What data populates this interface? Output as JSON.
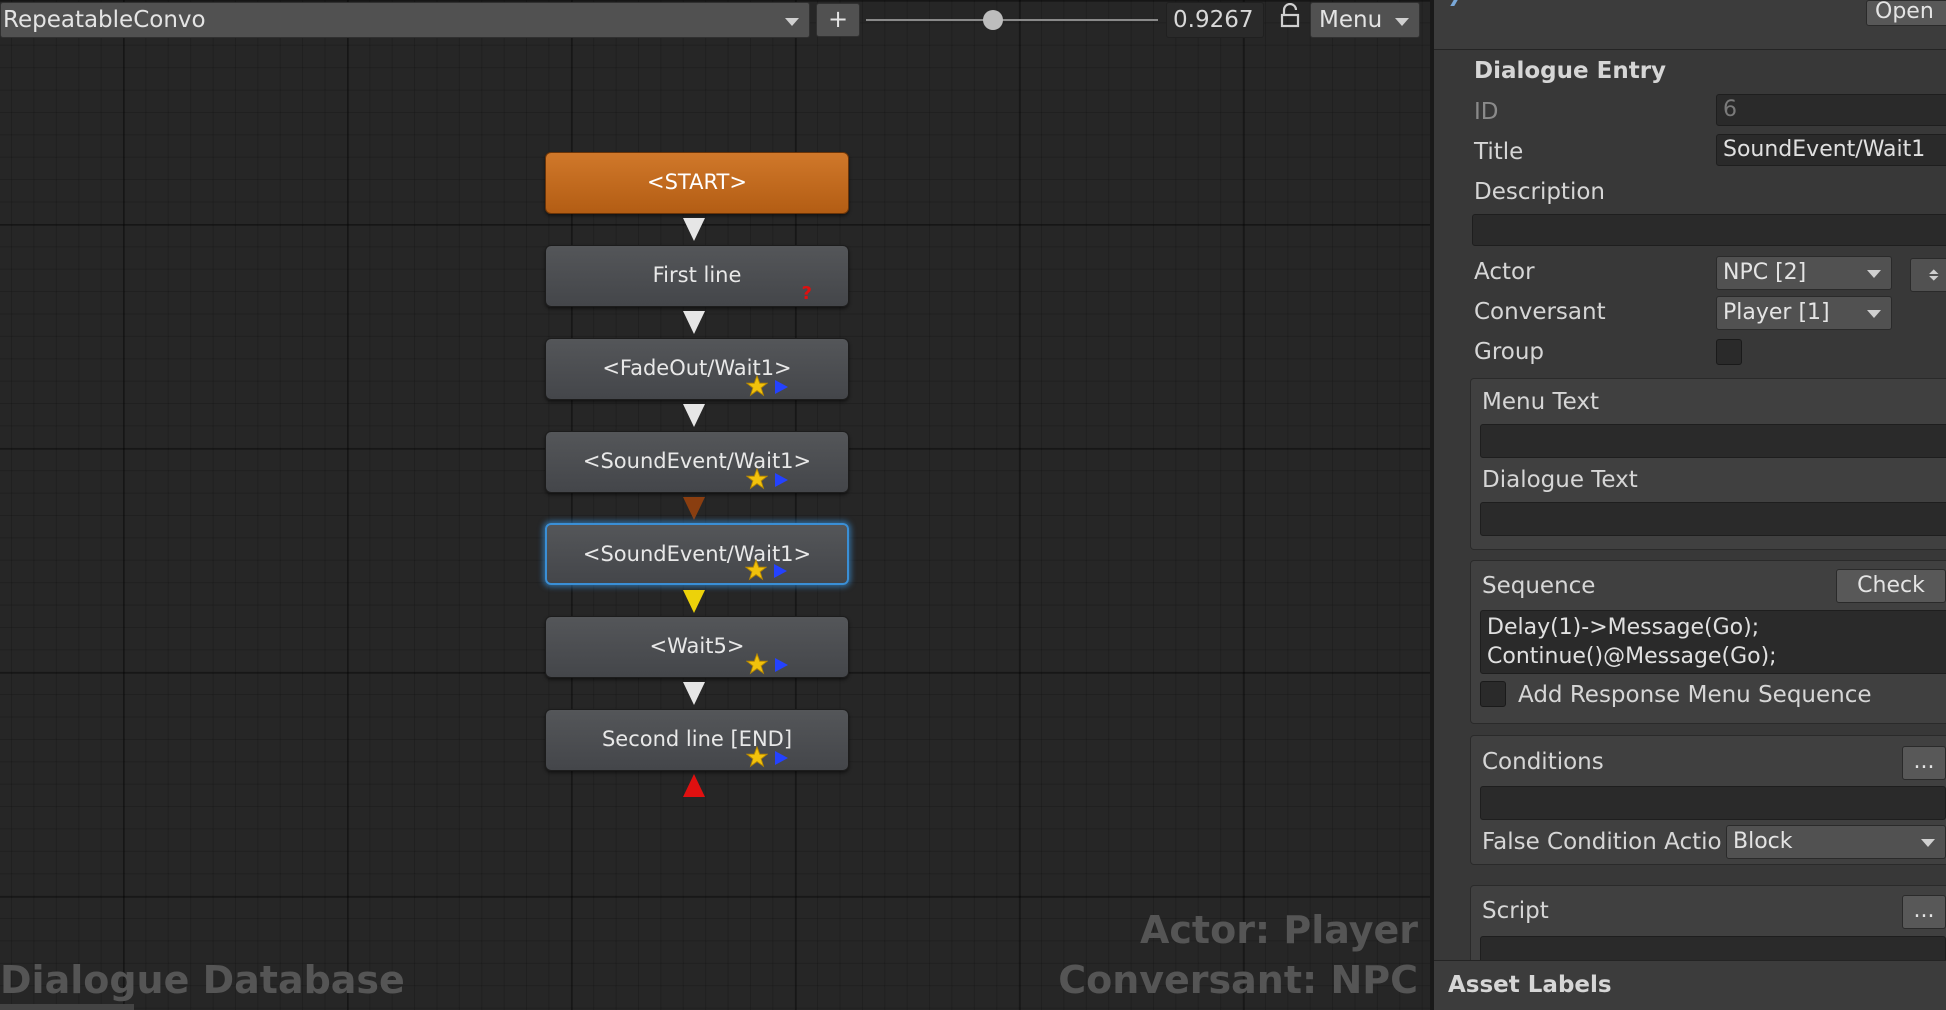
{
  "toolbar": {
    "conversation": "RepeatableConvo",
    "add_label": "+",
    "zoom": "0.9267",
    "menu_label": "Menu"
  },
  "graph": {
    "nodes": [
      {
        "label": "<START>"
      },
      {
        "label": "First line"
      },
      {
        "label": "<FadeOut/Wait1>"
      },
      {
        "label": "<SoundEvent/Wait1>"
      },
      {
        "label": "<SoundEvent/Wait1>"
      },
      {
        "label": "<Wait5>"
      },
      {
        "label": "Second line [END]"
      }
    ],
    "database_title": "Dialogue Database",
    "actor_line": "Actor: Player",
    "conversant_line": "Conversant: NPC"
  },
  "inspector": {
    "open_label": "Open",
    "section_title": "Dialogue Entry",
    "id_label": "ID",
    "id_value": "6",
    "title_label": "Title",
    "title_value": "SoundEvent/Wait1",
    "description_label": "Description",
    "description_value": "",
    "actor_label": "Actor",
    "actor_value": "NPC [2]",
    "conversant_label": "Conversant",
    "conversant_value": "Player [1]",
    "group_label": "Group",
    "menu_text_label": "Menu Text",
    "menu_text_value": "",
    "dialogue_text_label": "Dialogue Text",
    "dialogue_text_value": "",
    "sequence_label": "Sequence",
    "check_label": "Check",
    "sequence_line1": "Delay(1)->Message(Go);",
    "sequence_line2": "Continue()@Message(Go);",
    "add_response_label": "Add Response Menu Sequence",
    "conditions_label": "Conditions",
    "conditions_btn": "...",
    "conditions_value": "",
    "false_condition_label": "False Condition Actio",
    "false_condition_value": "Block",
    "script_label": "Script",
    "script_btn": "...",
    "asset_labels": "Asset Labels"
  },
  "colors": {
    "start_node": "#c66a1e",
    "selected_outline": "#3a8fd6",
    "link_normal": "#e6e6e6",
    "link_brown": "#8a3e10",
    "link_yellow": "#ecd20a",
    "end_marker": "#e01010"
  }
}
